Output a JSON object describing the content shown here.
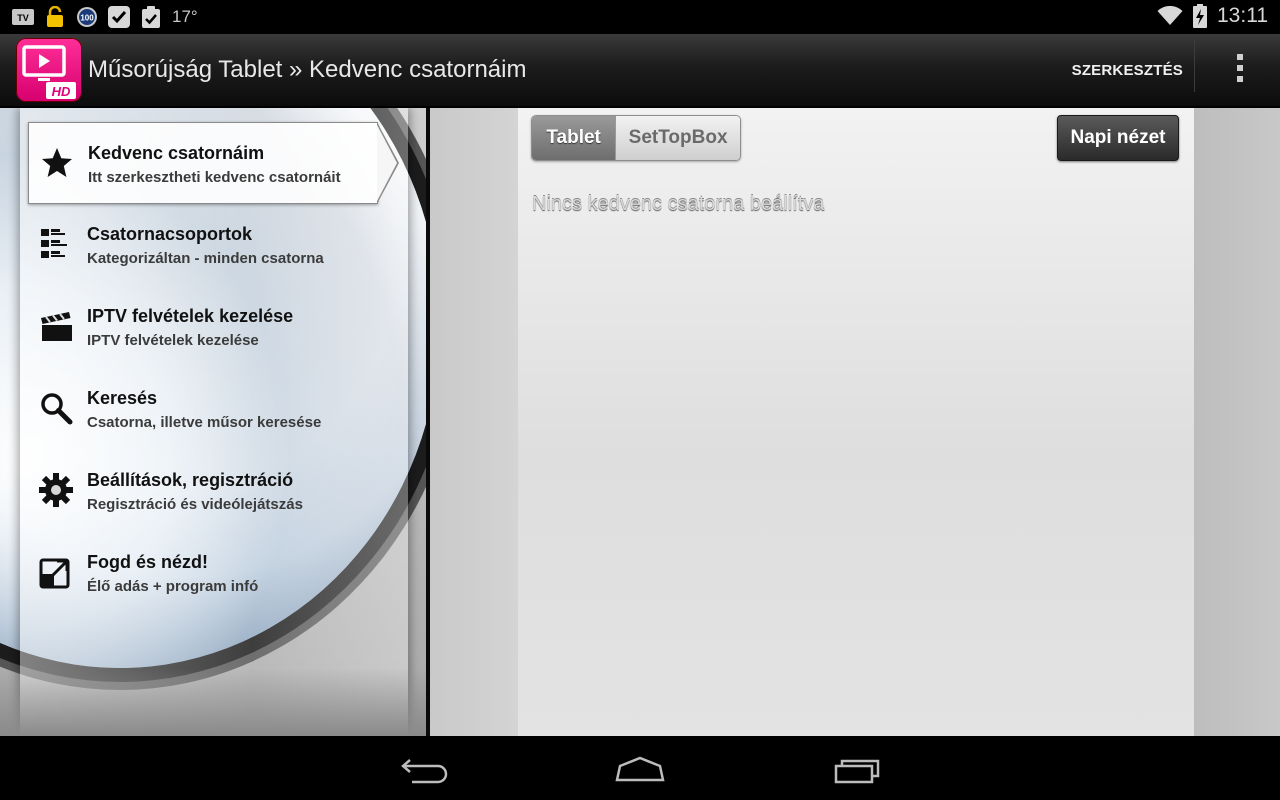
{
  "status_bar": {
    "temperature": "17°",
    "time": "13:11",
    "left_icons": [
      "tv-icon",
      "unlock-icon",
      "badge-100-icon",
      "checkmark-icon",
      "clipboard-check-icon"
    ],
    "right_icons": [
      "wifi-icon",
      "battery-charging-icon"
    ],
    "badge_text": "100",
    "tv_text": "TV"
  },
  "action_bar": {
    "logo_text": "HD",
    "title": "Műsorújság Tablet » Kedvenc csatornáim",
    "edit_label": "SZERKESZTÉS"
  },
  "sidebar": {
    "items": [
      {
        "icon": "star-icon",
        "title": "Kedvenc csatornáim",
        "subtitle": "Itt szerkesztheti kedvenc csatornáit",
        "selected": true
      },
      {
        "icon": "channel-list-icon",
        "title": "Csatornacsoportok",
        "subtitle": "Kategorizáltan - minden csatorna",
        "selected": false
      },
      {
        "icon": "clapperboard-icon",
        "title": "IPTV felvételek kezelése",
        "subtitle": "IPTV felvételek kezelése",
        "selected": false
      },
      {
        "icon": "search-icon",
        "title": "Keresés",
        "subtitle": "Csatorna, illetve műsor keresése",
        "selected": false
      },
      {
        "icon": "gear-icon",
        "title": "Beállítások, regisztráció",
        "subtitle": "Regisztráció és videólejátszás",
        "selected": false
      },
      {
        "icon": "external-link-icon",
        "title": "Fogd és nézd!",
        "subtitle": "Élő adás + program infó",
        "selected": false
      }
    ]
  },
  "main": {
    "segments": [
      {
        "label": "Tablet",
        "active": true
      },
      {
        "label": "SetTopBox",
        "active": false
      }
    ],
    "daily_view_label": "Napi nézet",
    "empty_message": "Nincs kedvenc csatorna beállítva"
  },
  "colors": {
    "brand": "#e2007a",
    "selected_segment": "#7a7a7a",
    "daily_button": "#3a3a3a"
  },
  "navigation_bar": {
    "buttons": [
      "back-icon",
      "home-icon",
      "recent-apps-icon"
    ]
  }
}
